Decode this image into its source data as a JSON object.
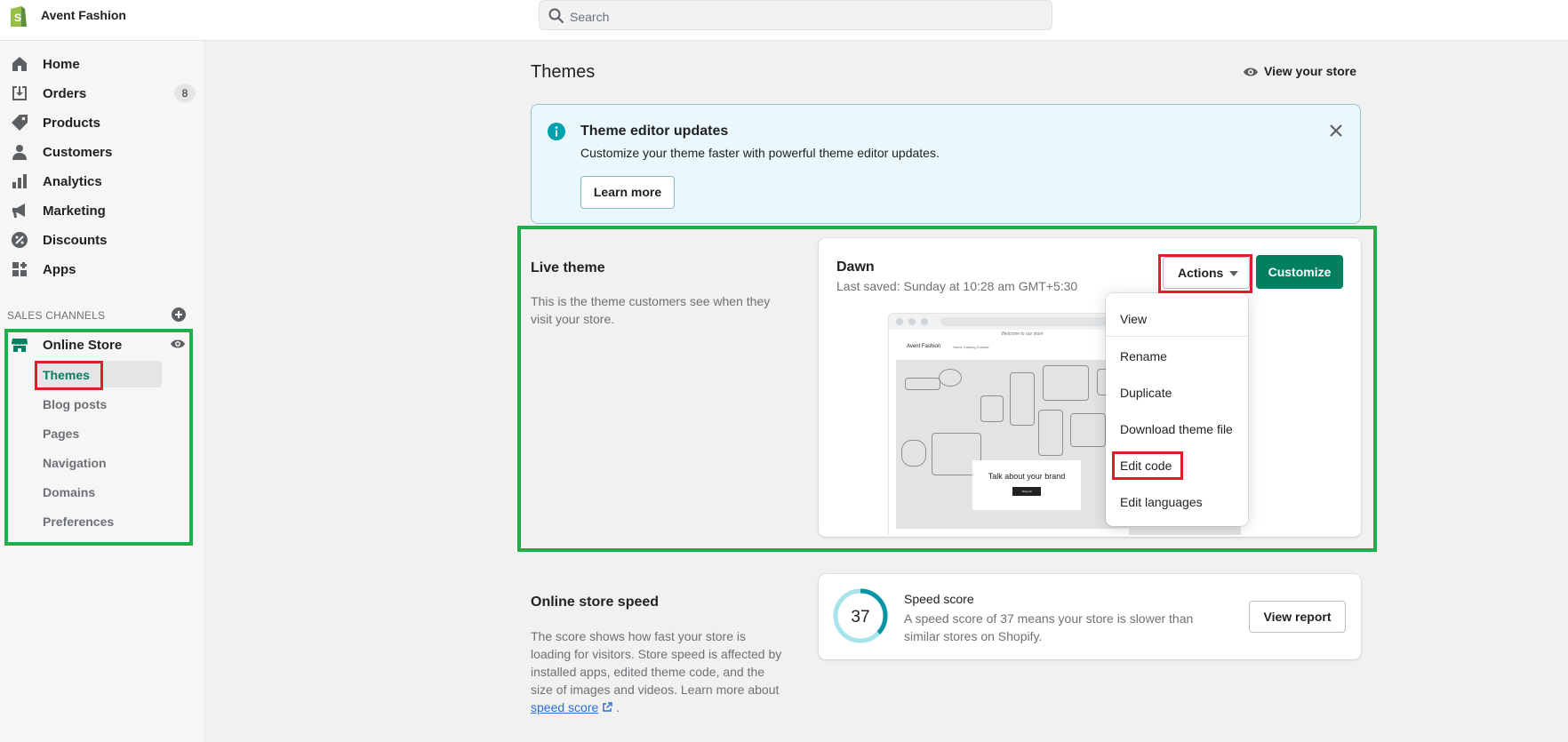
{
  "topbar": {
    "store_name": "Avent Fashion",
    "search_placeholder": "Search"
  },
  "sidebar": {
    "items": [
      {
        "label": "Home",
        "icon": "home-icon"
      },
      {
        "label": "Orders",
        "icon": "orders-icon",
        "badge": "8"
      },
      {
        "label": "Products",
        "icon": "tag-icon"
      },
      {
        "label": "Customers",
        "icon": "person-icon"
      },
      {
        "label": "Analytics",
        "icon": "bar-chart-icon"
      },
      {
        "label": "Marketing",
        "icon": "megaphone-icon"
      },
      {
        "label": "Discounts",
        "icon": "discount-icon"
      },
      {
        "label": "Apps",
        "icon": "apps-icon"
      }
    ],
    "sales_channels_header": "SALES CHANNELS",
    "online_store": {
      "label": "Online Store",
      "sub_items": [
        "Themes",
        "Blog posts",
        "Pages",
        "Navigation",
        "Domains",
        "Preferences"
      ],
      "active": "Themes"
    }
  },
  "main": {
    "title": "Themes",
    "view_store": "View your store",
    "banner": {
      "title": "Theme editor updates",
      "text": "Customize your theme faster with powerful theme editor updates.",
      "button": "Learn more"
    },
    "live_theme": {
      "section_title": "Live theme",
      "section_desc_1": "This is the theme customers see when they",
      "section_desc_2": "visit your store.",
      "theme_name": "Dawn",
      "last_saved": "Last saved: Sunday at 10:28 am GMT+5:30",
      "actions_label": "Actions",
      "customize_label": "Customize",
      "preview": {
        "announcement": "Welcome to our store",
        "store_logo": "Avent Fashion",
        "nav": "Home    Catalog    Contact",
        "hero_title": "Talk about your brand",
        "hero_button": "Shop all"
      }
    },
    "actions_menu": [
      "View",
      "Rename",
      "Duplicate",
      "Download theme file",
      "Edit code",
      "Edit languages"
    ],
    "speed": {
      "section_title": "Online store speed",
      "desc_lines": [
        "The score shows how fast your store is",
        "loading for visitors. Store speed is affected by",
        "installed apps, edited theme code, and the",
        "size of images and videos. Learn more about"
      ],
      "link": "speed score",
      "score": "37",
      "score_fraction": 0.37,
      "label": "Speed score",
      "text": "A speed score of 37 means your store is slower than similar stores on Shopify.",
      "button": "View report"
    }
  },
  "colors": {
    "accent_green": "#008060",
    "highlight_green": "#1fae4a",
    "highlight_red": "#e01e2b",
    "banner_bg": "#eaf7fb"
  }
}
